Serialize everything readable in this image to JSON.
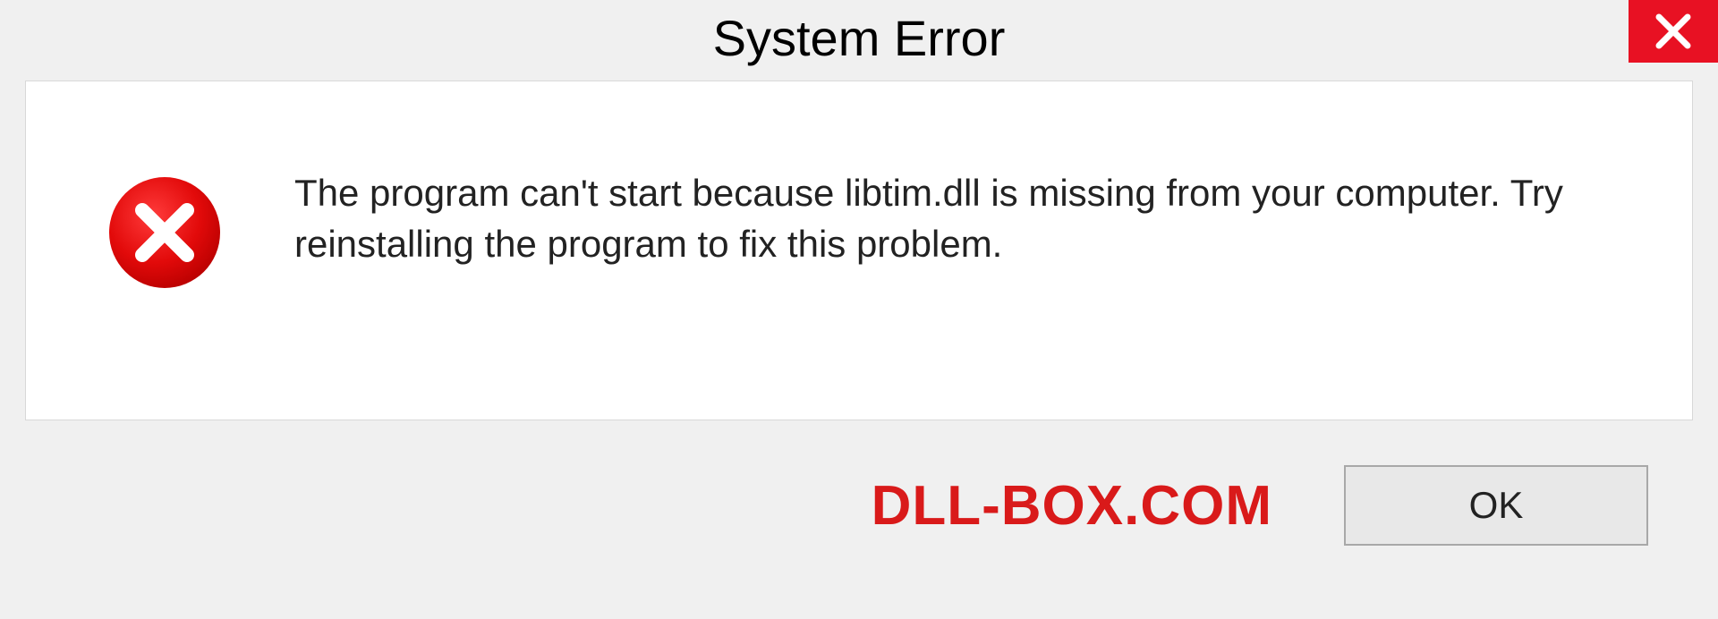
{
  "titlebar": {
    "title": "System Error"
  },
  "dialog": {
    "message": "The program can't start because libtim.dll is missing from your computer. Try reinstalling the program to fix this problem."
  },
  "footer": {
    "brand": "DLL-BOX.COM",
    "ok_label": "OK"
  }
}
